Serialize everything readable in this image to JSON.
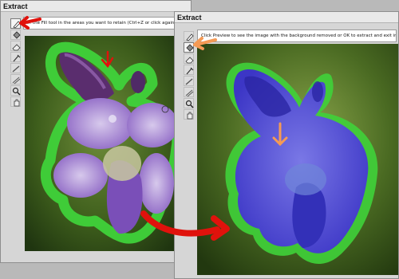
{
  "window_left": {
    "title": "Extract",
    "instruction": "... the Fill tool in the areas you want to retain (Ctrl+Z or click again to undo)."
  },
  "window_right": {
    "title": "Extract",
    "instruction": "Click Preview to see the image with the background removed or OK to extract and exit immediately."
  },
  "toolbar": [
    {
      "name": "edge-highlighter-tool",
      "icon": "highlighter-icon"
    },
    {
      "name": "fill-tool",
      "icon": "paint-bucket-icon"
    },
    {
      "name": "eraser-tool",
      "icon": "eraser-icon"
    },
    {
      "name": "eyedropper-tool",
      "icon": "eyedropper-icon"
    },
    {
      "name": "cleanup-tool",
      "icon": "cleanup-icon"
    },
    {
      "name": "edge-touchup-tool",
      "icon": "edge-touchup-icon"
    },
    {
      "name": "zoom-tool",
      "icon": "zoom-icon"
    },
    {
      "name": "hand-tool",
      "icon": "hand-icon"
    }
  ],
  "colors": {
    "highlight_green": "#3fd23a",
    "fill_blue": "#4a49d8",
    "annotation_red": "#e0120c",
    "annotation_orange": "#f59a55",
    "flower_purple": "#9a7ad0"
  }
}
